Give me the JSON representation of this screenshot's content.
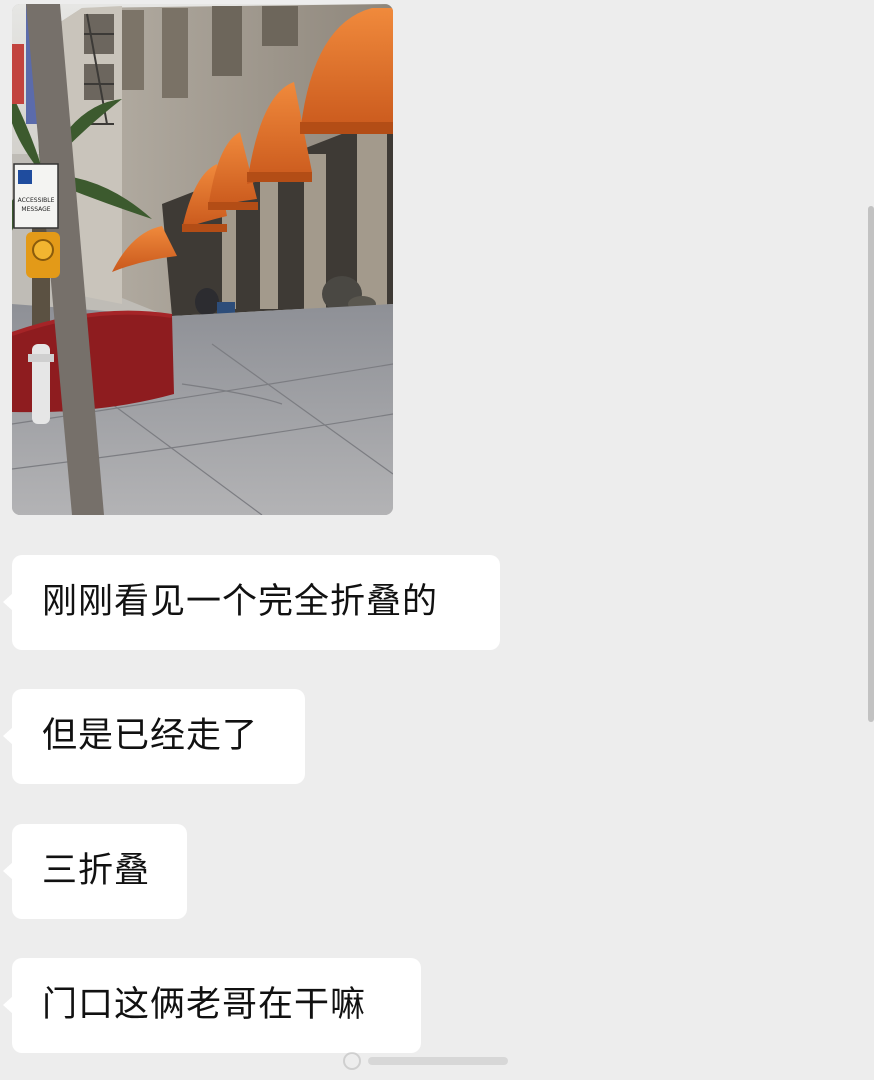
{
  "chat": {
    "messages": [
      {
        "type": "image",
        "description_icon": "street-photo"
      },
      {
        "type": "text",
        "text": "刚刚看见一个完全折叠的"
      },
      {
        "type": "text",
        "text": "但是已经走了"
      },
      {
        "type": "text",
        "text": "三折叠"
      },
      {
        "type": "text",
        "text": "门口这俩老哥在干嘛"
      }
    ]
  },
  "photo": {
    "sign_line1": "ACCESSIBLE",
    "sign_line2": "MESSAGE"
  },
  "colors": {
    "background": "#ededed",
    "bubble": "#ffffff",
    "awning": "#e7722a",
    "planter": "#8e1c1f"
  }
}
